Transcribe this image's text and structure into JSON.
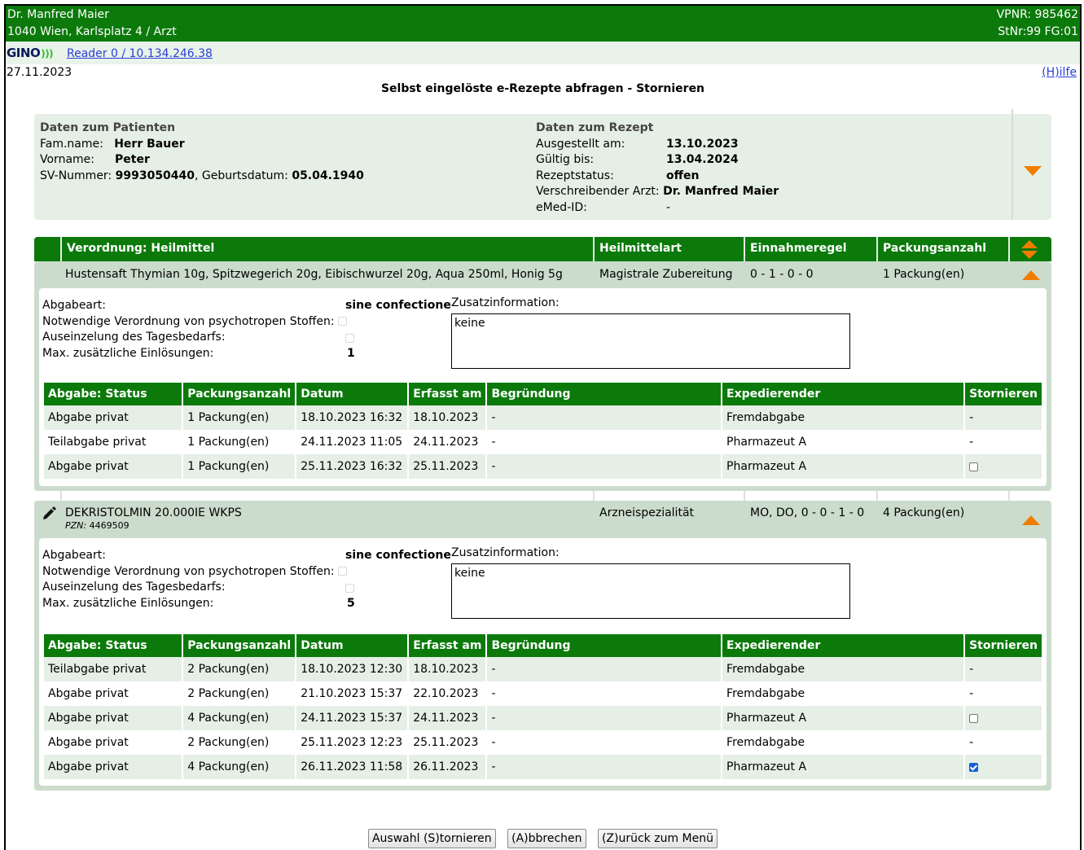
{
  "header": {
    "doctor_name": "Dr. Manfred Maier",
    "address": "1040 Wien, Karlsplatz 4 / Arzt",
    "vpnr": "VPNR: 985462",
    "stnr": "StNr:99 FG:01",
    "logo_text": "GINO",
    "reader_link": "Reader 0 / 10.134.246.38",
    "date": "27.11.2023",
    "help_link": "(H)ilfe",
    "page_title": "Selbst eingelöste e-Rezepte abfragen - Stornieren"
  },
  "patient": {
    "section_title": "Daten zum Patienten",
    "famname_label": "Fam.name:",
    "famname": "Herr Bauer",
    "vorname_label": "Vorname:",
    "vorname": "Peter",
    "sv_label": "SV-Nummer:",
    "sv": "9993050440",
    "geb_label": ", Geburtsdatum:",
    "geb": "05.04.1940"
  },
  "rezept": {
    "section_title": "Daten zum Rezept",
    "ausgestellt_label": "Ausgestellt am:",
    "ausgestellt": "13.10.2023",
    "gueltig_label": "Gültig bis:",
    "gueltig": "13.04.2024",
    "status_label": "Rezeptstatus:",
    "status": "offen",
    "arzt_label": "Verschreibender Arzt:",
    "arzt": "Dr. Manfred Maier",
    "emed_label": "eMed-ID:",
    "emed": "-"
  },
  "table_header": {
    "verordnung": "Verordnung: Heilmittel",
    "art": "Heilmittelart",
    "regel": "Einnahmeregel",
    "anzahl": "Packungsanzahl"
  },
  "detail_labels": {
    "abgabeart": "Abgabeart:",
    "psycho": "Notwendige Verordnung von psychotropen Stoffen:",
    "tages": "Auseinzelung des Tagesbedarfs:",
    "max": "Max. zusätzliche Einlösungen:",
    "zusatz": "Zusatzinformation:"
  },
  "sub_headers": {
    "status": "Abgabe: Status",
    "anzahl": "Packungsanzahl",
    "datum": "Datum",
    "erfasst": "Erfasst am",
    "begruendung": "Begründung",
    "exped": "Expedierender",
    "storno": "Stornieren"
  },
  "meds": [
    {
      "name": "Hustensaft Thymian 10g, Spitzwegerich 20g, Eibischwurzel 20g, Aqua 250ml, Honig 5g",
      "pzn": "",
      "art": "Magistrale Zubereitung",
      "regel": "0 - 1 - 0 - 0",
      "anzahl": "1 Packung(en)",
      "abgabeart": "sine confectione",
      "max": "1",
      "zusatz": "keine",
      "rows": [
        {
          "status": "Abgabe privat",
          "anzahl": "1 Packung(en)",
          "datum": "18.10.2023 16:32",
          "erfasst": "18.10.2023",
          "begr": "-",
          "exped": "Fremdabgabe",
          "storno": "-"
        },
        {
          "status": "Teilabgabe privat",
          "anzahl": "1 Packung(en)",
          "datum": "24.11.2023 11:05",
          "erfasst": "24.11.2023",
          "begr": "-",
          "exped": "Pharmazeut A",
          "storno": "-"
        },
        {
          "status": "Abgabe privat",
          "anzahl": "1 Packung(en)",
          "datum": "25.11.2023 16:32",
          "erfasst": "25.11.2023",
          "begr": "-",
          "exped": "Pharmazeut A",
          "storno": "checkbox"
        }
      ]
    },
    {
      "name": "DEKRISTOLMIN 20.000IE WKPS",
      "pzn_label": "PZN:",
      "pzn": "4469509",
      "art": "Arzneispezialität",
      "regel": "MO, DO, 0 - 0 - 1 - 0",
      "anzahl": "4 Packung(en)",
      "abgabeart": "sine confectione",
      "max": "5",
      "zusatz": "keine",
      "rows": [
        {
          "status": "Teilabgabe privat",
          "anzahl": "2 Packung(en)",
          "datum": "18.10.2023 12:30",
          "erfasst": "18.10.2023",
          "begr": "-",
          "exped": "Fremdabgabe",
          "storno": "-"
        },
        {
          "status": "Abgabe privat",
          "anzahl": "2 Packung(en)",
          "datum": "21.10.2023 15:37",
          "erfasst": "22.10.2023",
          "begr": "-",
          "exped": "Fremdabgabe",
          "storno": "-"
        },
        {
          "status": "Abgabe privat",
          "anzahl": "4 Packung(en)",
          "datum": "24.11.2023 15:37",
          "erfasst": "24.11.2023",
          "begr": "-",
          "exped": "Pharmazeut A",
          "storno": "checkbox"
        },
        {
          "status": "Abgabe privat",
          "anzahl": "2 Packung(en)",
          "datum": "25.11.2023 12:23",
          "erfasst": "25.11.2023",
          "begr": "-",
          "exped": "Fremdabgabe",
          "storno": "-"
        },
        {
          "status": "Abgabe privat",
          "anzahl": "4 Packung(en)",
          "datum": "26.11.2023 11:58",
          "erfasst": "26.11.2023",
          "begr": "-",
          "exped": "Pharmazeut A",
          "storno": "checked"
        }
      ]
    }
  ],
  "buttons": {
    "stornieren": "Auswahl (S)tornieren",
    "abbrechen": "(A)bbrechen",
    "zurueck": "(Z)urück zum Menü"
  },
  "colors": {
    "green": "#0b7a0b",
    "orange": "#f07d00",
    "light_green": "#e6efe6"
  }
}
